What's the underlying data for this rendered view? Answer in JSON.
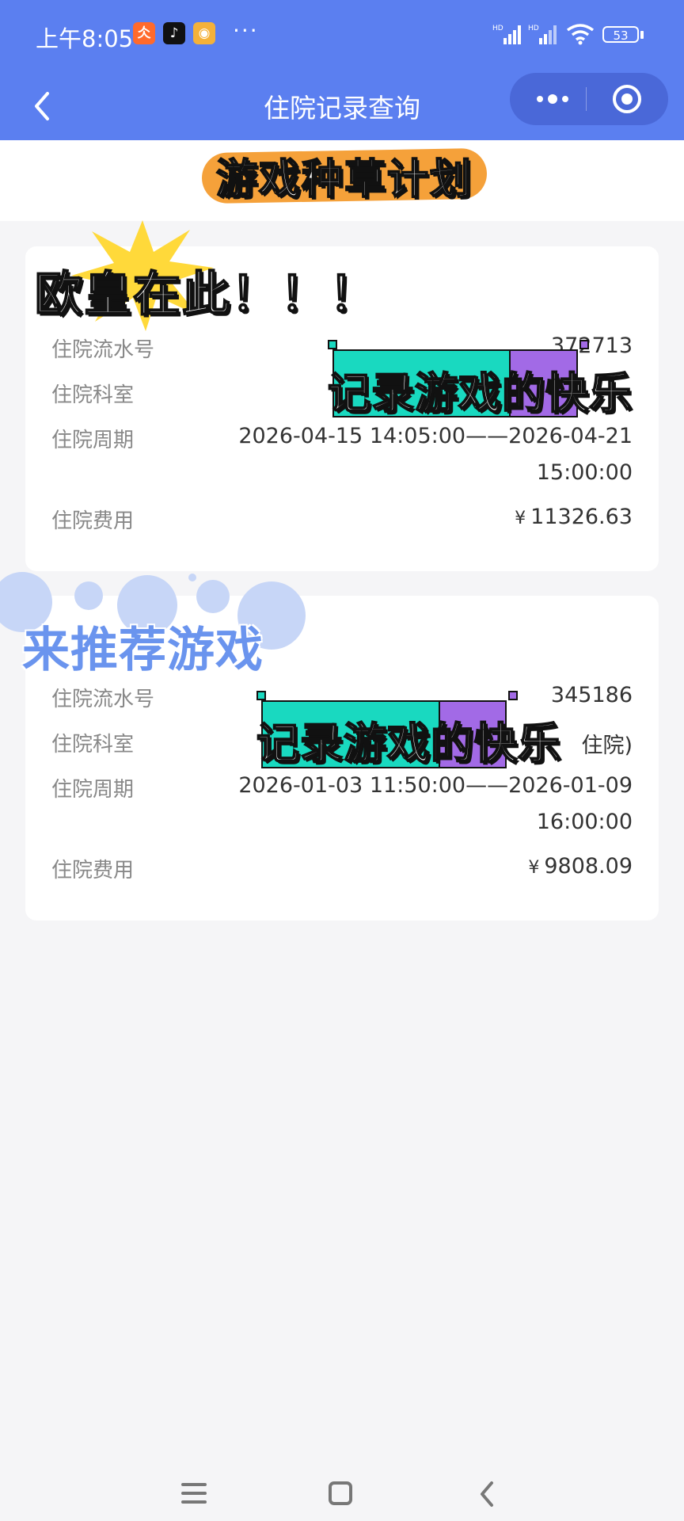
{
  "status_bar": {
    "time": "上午8:05",
    "more_dots": "···",
    "battery": "53",
    "app_icons": [
      {
        "name": "taobao-like-app-icon",
        "glyph": "仌",
        "color": "#ff6a2c"
      },
      {
        "name": "tiktok-icon",
        "glyph": "♪",
        "color": "#111111"
      },
      {
        "name": "weibo-icon",
        "glyph": "◉",
        "color": "#f4b13a"
      }
    ]
  },
  "nav": {
    "title": "住院记录查询"
  },
  "banner": {
    "text": "游戏种草计划"
  },
  "records": [
    {
      "rows": [
        {
          "label": "住院流水号",
          "value": "372713"
        },
        {
          "label": "住院科室",
          "value": ""
        },
        {
          "label": "住院周期",
          "value": "2026-04-15 14:05:00——2026-04-21",
          "value2": "15:00:00"
        },
        {
          "label": "住院费用",
          "currency": "¥",
          "value": "11326.63"
        }
      ]
    },
    {
      "rows": [
        {
          "label": "住院流水号",
          "value": "345186"
        },
        {
          "label": "住院科室",
          "value": "住院)"
        },
        {
          "label": "住院周期",
          "value": "2026-01-03 11:50:00——2026-01-09",
          "value2": "16:00:00"
        },
        {
          "label": "住院费用",
          "currency": "¥",
          "value": "9808.09"
        }
      ]
    }
  ],
  "stickers": {
    "ouhuang": "欧皇在此！！！",
    "tuijian": "来推荐游戏",
    "fun": "记录游戏的快乐"
  },
  "colors": {
    "header_blue": "#5b7ff0",
    "capsule_blue": "#4a68d8",
    "banner_orange": "#f5a13a",
    "teal": "#19d9c0",
    "purple": "#a26ae6",
    "starburst_yellow": "#ffd93a"
  }
}
